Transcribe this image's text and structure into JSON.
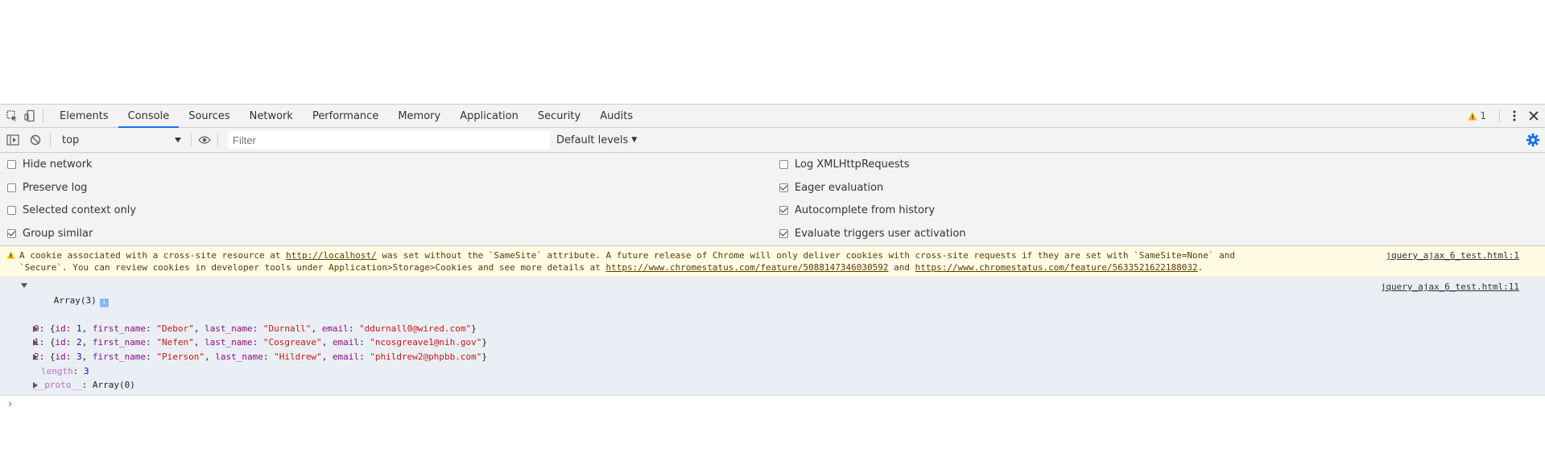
{
  "tabs": [
    "Elements",
    "Console",
    "Sources",
    "Network",
    "Performance",
    "Memory",
    "Application",
    "Security",
    "Audits"
  ],
  "active_tab": "Console",
  "warning_count": "1",
  "toolbar": {
    "context": "top",
    "filter_placeholder": "Filter",
    "levels_label": "Default levels"
  },
  "settings": {
    "left": [
      {
        "label": "Hide network",
        "checked": false
      },
      {
        "label": "Preserve log",
        "checked": false
      },
      {
        "label": "Selected context only",
        "checked": false
      },
      {
        "label": "Group similar",
        "checked": true
      }
    ],
    "right": [
      {
        "label": "Log XMLHttpRequests",
        "checked": false
      },
      {
        "label": "Eager evaluation",
        "checked": true
      },
      {
        "label": "Autocomplete from history",
        "checked": true
      },
      {
        "label": "Evaluate triggers user activation",
        "checked": true
      }
    ]
  },
  "warning": {
    "line1_a": "A cookie associated with a cross-site resource at ",
    "link1": "http://localhost/",
    "line1_b": " was set without the `SameSite` attribute. A future release of Chrome will only deliver cookies with cross-site requests if they are set with `SameSite=None` and",
    "line2_a": "`Secure`. You can review cookies in developer tools under Application>Storage>Cookies and see more details at ",
    "link2": "https://www.chromestatus.com/feature/5088147346030592",
    "line2_b": " and ",
    "link3": "https://www.chromestatus.com/feature/5633521622188032",
    "line2_c": ".",
    "source": "jquery_ajax_6_test.html:1"
  },
  "log": {
    "header": "Array(3)",
    "info_badge": "i",
    "source": "jquery_ajax_6_test.html:11",
    "items": [
      {
        "index": "0",
        "id": "1",
        "first_name": "\"Debor\"",
        "last_name": "\"Durnall\"",
        "email": "\"ddurnall0@wired.com\""
      },
      {
        "index": "1",
        "id": "2",
        "first_name": "\"Nefen\"",
        "last_name": "\"Cosgreave\"",
        "email": "\"ncosgreave1@nih.gov\""
      },
      {
        "index": "2",
        "id": "3",
        "first_name": "\"Pierson\"",
        "last_name": "\"Hildrew\"",
        "email": "\"phildrew2@phpbb.com\""
      }
    ],
    "length_key": "length",
    "length_value": "3",
    "proto_key": "__proto__",
    "proto_value": "Array(0)"
  },
  "prompt": "›",
  "colors": {
    "accent": "#1a73e8",
    "warning_bg": "#fffbe5",
    "log_bg": "#eaeef5",
    "string": "#c41a16",
    "number": "#1c00cf",
    "key": "#881280"
  }
}
